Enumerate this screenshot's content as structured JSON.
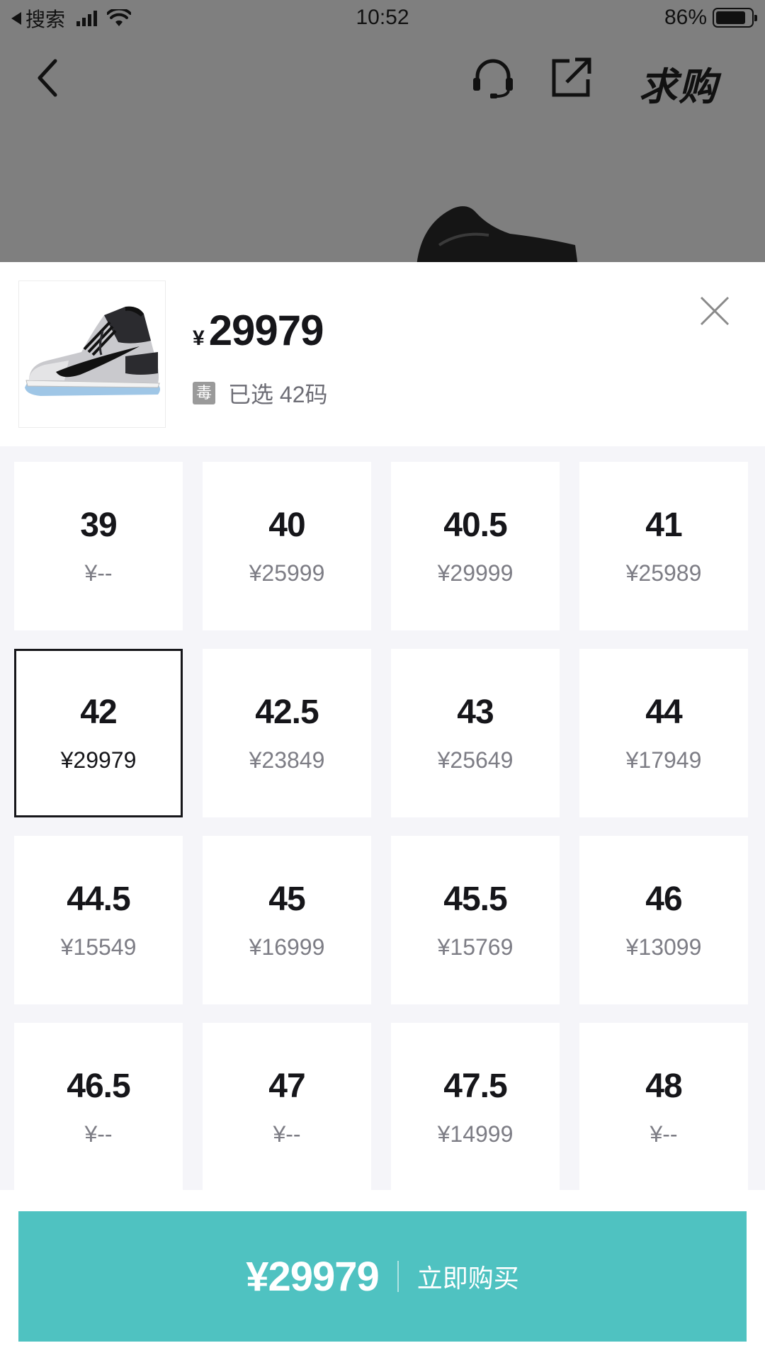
{
  "status_bar": {
    "back_app": "搜索",
    "time": "10:52",
    "battery": "86%",
    "battery_level": 0.86
  },
  "nav": {
    "want_label": "求购"
  },
  "product": {
    "currency": "¥",
    "price": "29979",
    "brand_badge": "毒",
    "selected_text": "已选 42码"
  },
  "sizes": [
    {
      "size": "39",
      "price": "¥--"
    },
    {
      "size": "40",
      "price": "¥25999"
    },
    {
      "size": "40.5",
      "price": "¥29999"
    },
    {
      "size": "41",
      "price": "¥25989"
    },
    {
      "size": "42",
      "price": "¥29979",
      "selected": true
    },
    {
      "size": "42.5",
      "price": "¥23849"
    },
    {
      "size": "43",
      "price": "¥25649"
    },
    {
      "size": "44",
      "price": "¥17949"
    },
    {
      "size": "44.5",
      "price": "¥15549"
    },
    {
      "size": "45",
      "price": "¥16999"
    },
    {
      "size": "45.5",
      "price": "¥15769"
    },
    {
      "size": "46",
      "price": "¥13099"
    },
    {
      "size": "46.5",
      "price": "¥--"
    },
    {
      "size": "47",
      "price": "¥--"
    },
    {
      "size": "47.5",
      "price": "¥14999"
    },
    {
      "size": "48",
      "price": "¥--"
    }
  ],
  "buy_bar": {
    "price": "¥29979",
    "label": "立即购买"
  },
  "colors": {
    "accent": "#4fc2c1",
    "text_primary": "#16161a",
    "text_secondary": "#7d7d85",
    "grid_bg": "#f5f5f9",
    "overlay": "#7f7f7f"
  },
  "icons": [
    "back-arrow-icon",
    "signal-icon",
    "wifi-icon",
    "battery-icon",
    "chevron-left-icon",
    "headset-icon",
    "share-icon",
    "close-icon"
  ]
}
